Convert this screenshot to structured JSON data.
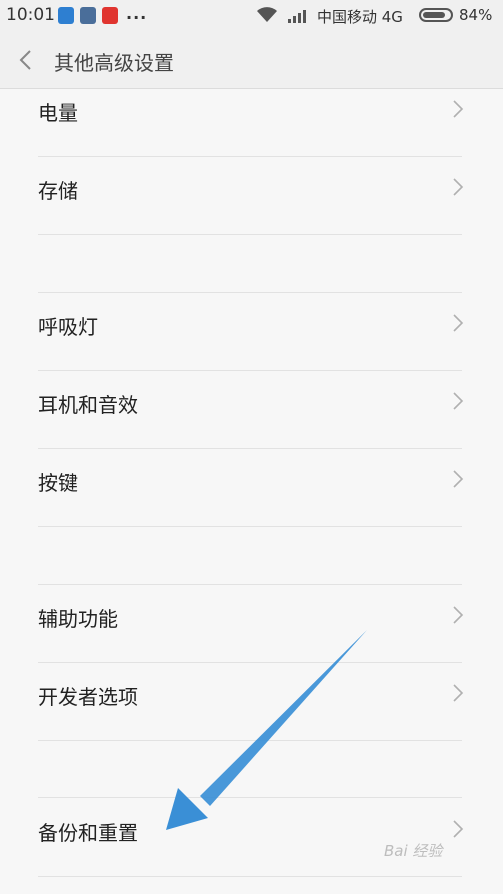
{
  "status_bar": {
    "time": "10:01",
    "more": "...",
    "carrier": "中国移动 4G",
    "battery": "84%",
    "battery_level": 0.84
  },
  "header": {
    "title": "其他高级设置"
  },
  "items": [
    {
      "label": "电量"
    },
    {
      "label": "存储"
    },
    {
      "label": "呼吸灯"
    },
    {
      "label": "耳机和音效"
    },
    {
      "label": "按键"
    },
    {
      "label": "辅助功能"
    },
    {
      "label": "开发者选项"
    },
    {
      "label": "备份和重置"
    }
  ],
  "colors": {
    "annotation_arrow": "#3a8fd6",
    "background": "#f7f7f7"
  },
  "watermark": "Bai 经验"
}
